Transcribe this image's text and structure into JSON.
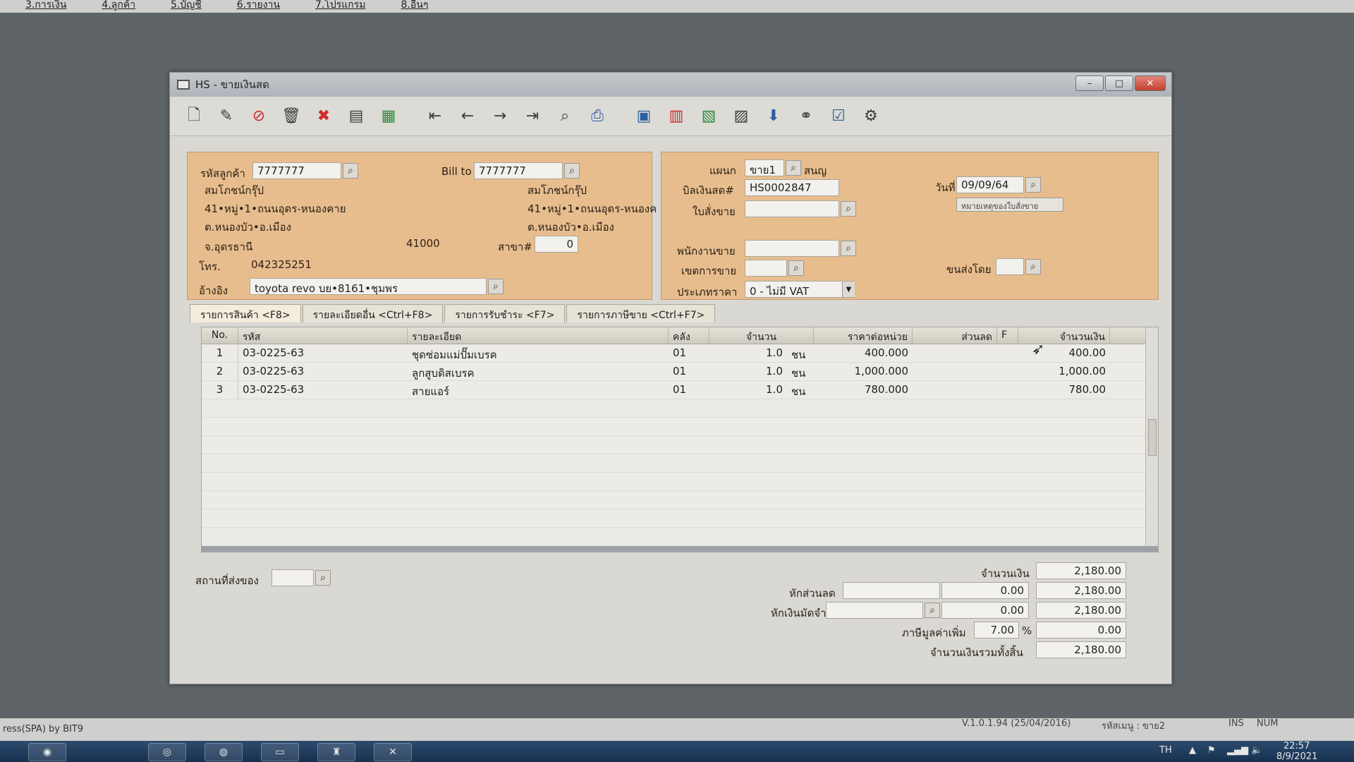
{
  "top_menu": [
    "3.การเงิน",
    "4.ลูกค้า",
    "5.บัญชี",
    "6.รายงาน",
    "7.โปรแกรม",
    "8.อื่นๆ"
  ],
  "window": {
    "title": "HS - ขายเงินสด",
    "min_label": "–",
    "max_label": "□",
    "close_label": "✕"
  },
  "toolbar_icons": [
    "new-document-icon",
    "edit-icon",
    "void-icon",
    "delete-icon",
    "cancel-icon",
    "save-icon",
    "books-icon",
    "first-record-icon",
    "previous-record-icon",
    "next-record-icon",
    "last-record-icon",
    "search-document-icon",
    "print-icon",
    "calculator-icon",
    "report-icon",
    "stock-icon",
    "barcode-icon",
    "approve-icon",
    "link-icon",
    "ok-icon",
    "settings-icon"
  ],
  "customer": {
    "code_label": "รหัสลูกค้า",
    "code": "7777777",
    "name": "สมโภชน์กรุ๊ป",
    "address1": "41•หมู่•1•ถนนอุดร-หนองคาย",
    "address2": "ต.หนองบัว•อ.เมือง",
    "province": "จ.อุดรธานี",
    "postcode": "41000",
    "phone_label": "โทร.",
    "phone": "042325251",
    "ref_label": "อ้างอิง",
    "ref": "toyota revo บย•8161•ชุมพร"
  },
  "bill_to": {
    "label": "Bill to",
    "code": "7777777",
    "name": "สมโภชน์กรุ๊ป",
    "address1": "41•หมู่•1•ถนนอุดร-หนองค",
    "address2": "ต.หนองบัว•อ.เมือง",
    "branch_label": "สาขา#",
    "branch": "0"
  },
  "doc": {
    "dept_label": "แผนก",
    "dept": "ขาย1",
    "dept_name": "สนญ",
    "bill_label": "บิลเงินสด#",
    "bill_no": "HS0002847",
    "date_label": "วันที่",
    "date": "09/09/64",
    "order_label": "ใบสั่งขาย",
    "order_note_button": "หมายเหตุของใบสั่งขาย",
    "salesman_label": "พนักงานขาย",
    "area_label": "เขตการขาย",
    "ship_by_label": "ขนส่งโดย",
    "price_type_label": "ประเภทราคา",
    "price_type": "0 - ไม่มี VAT"
  },
  "tabs": [
    "รายการสินค้า <F8>",
    "รายละเอียดอื่น <Ctrl+F8>",
    "รายการรับชำระ <F7>",
    "รายการภาษีขาย <Ctrl+F7>"
  ],
  "grid": {
    "headers": {
      "no": "No.",
      "code": "รหัส",
      "desc": "รายละเอียด",
      "wh": "คลัง",
      "qty": "จำนวน",
      "price": "ราคาต่อหน่วย",
      "disc": "ส่วนลด",
      "f": "F",
      "amt": "จำนวนเงิน"
    },
    "rows": [
      {
        "no": "1",
        "code": "03-0225-63",
        "desc": "ชุดซ่อมแม่ปั๊มเบรค",
        "wh": "01",
        "qty": "1.0",
        "unit": "ชน",
        "price": "400.000",
        "disc": "",
        "f": "",
        "amt": "400.00"
      },
      {
        "no": "2",
        "code": "03-0225-63",
        "desc": "ลูกสูบดิสเบรค",
        "wh": "01",
        "qty": "1.0",
        "unit": "ชน",
        "price": "1,000.000",
        "disc": "",
        "f": "",
        "amt": "1,000.00"
      },
      {
        "no": "3",
        "code": "03-0225-63",
        "desc": "สายแอร์",
        "wh": "01",
        "qty": "1.0",
        "unit": "ชน",
        "price": "780.000",
        "disc": "",
        "f": "",
        "amt": "780.00"
      }
    ]
  },
  "footer": {
    "ship_place_label": "สถานที่ส่งของ",
    "amount_label": "จำนวนเงิน",
    "amount": "2,180.00",
    "discount_label": "หักส่วนลด",
    "discount": "0.00",
    "after_discount": "2,180.00",
    "deposit_label": "หักเงินมัดจำ",
    "deposit": "0.00",
    "after_deposit": "2,180.00",
    "vat_label": "ภาษีมูลค่าเพิ่ม",
    "vat_rate": "7.00",
    "vat_pct": "%",
    "vat_amount": "0.00",
    "total_label": "จำนวนเงินรวมทั้งสิ้น",
    "total": "2,180.00"
  },
  "statusbar": {
    "left": "ress(SPA) by BIT9",
    "version": "V.1.0.1.94 (25/04/2016)",
    "user": "รหัสเมนู : ขาย2",
    "ins": "INS",
    "num": "NUM"
  },
  "taskbar": {
    "lang": "TH",
    "time": "22:57",
    "date": "8/9/2021"
  }
}
